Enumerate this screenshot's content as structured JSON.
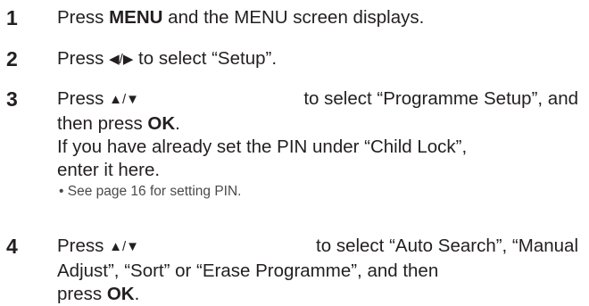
{
  "steps": [
    {
      "number": "1",
      "text_before": "Press ",
      "bold_key": "MENU",
      "text_after": " and the MENU screen displays."
    },
    {
      "number": "2",
      "text_before": "Press ",
      "arrows": "◀/▶",
      "text_after": " to select “Setup”."
    },
    {
      "number": "3",
      "line1_before": "Press ",
      "line1_arrows": "▲/▼",
      "line1_after": " to select “Programme Setup”, and",
      "line2_before": "then press ",
      "line2_bold": "OK",
      "line2_after": ".",
      "line3": "If you have already set the PIN under “Child Lock”,",
      "line4": "enter it here.",
      "note": "• See page 16 for setting PIN."
    },
    {
      "number": "4",
      "line1_before": "Press ",
      "line1_arrows": "▲/▼",
      "line1_after": " to select “Auto Search”, “Manual",
      "line2": "Adjust”, “Sort” or “Erase Programme”, and then",
      "line3_before": "press ",
      "line3_bold": "OK",
      "line3_after": "."
    }
  ]
}
